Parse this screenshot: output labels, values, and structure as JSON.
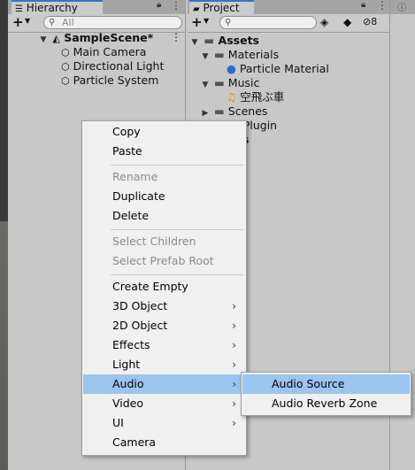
{
  "hierarchy": {
    "tab_title": "Hierarchy",
    "search_placeholder": "All",
    "scene_name": "SampleScene*",
    "objects": [
      "Main Camera",
      "Directional Light",
      "Particle System"
    ]
  },
  "project": {
    "tab_title": "Project",
    "hidden_count": "8",
    "tree": {
      "assets": "Assets",
      "materials": "Materials",
      "particle_material": "Particle Material",
      "music": "Music",
      "music_file": "空飛ぶ車",
      "scenes": "Scenes",
      "plugin": "YLY_Plugin",
      "packages": "ages"
    }
  },
  "context_menu": {
    "items": [
      {
        "label": "Copy",
        "enabled": true
      },
      {
        "label": "Paste",
        "enabled": true
      },
      {
        "label": "Rename",
        "enabled": false
      },
      {
        "label": "Duplicate",
        "enabled": true
      },
      {
        "label": "Delete",
        "enabled": true
      },
      {
        "label": "Select Children",
        "enabled": false
      },
      {
        "label": "Select Prefab Root",
        "enabled": false
      },
      {
        "label": "Create Empty",
        "enabled": true
      },
      {
        "label": "3D Object",
        "enabled": true,
        "submenu": true
      },
      {
        "label": "2D Object",
        "enabled": true,
        "submenu": true
      },
      {
        "label": "Effects",
        "enabled": true,
        "submenu": true
      },
      {
        "label": "Light",
        "enabled": true,
        "submenu": true
      },
      {
        "label": "Audio",
        "enabled": true,
        "submenu": true,
        "highlighted": true
      },
      {
        "label": "Video",
        "enabled": true,
        "submenu": true
      },
      {
        "label": "UI",
        "enabled": true,
        "submenu": true
      },
      {
        "label": "Camera",
        "enabled": true
      }
    ]
  },
  "audio_submenu": {
    "items": [
      {
        "label": "Audio Source",
        "highlighted": true
      },
      {
        "label": "Audio Reverb Zone"
      }
    ]
  },
  "colors": {
    "menu_highlight": "#99c5ee",
    "tab_accent": "#3a72c4",
    "panel_bg": "#c8c8c8"
  }
}
